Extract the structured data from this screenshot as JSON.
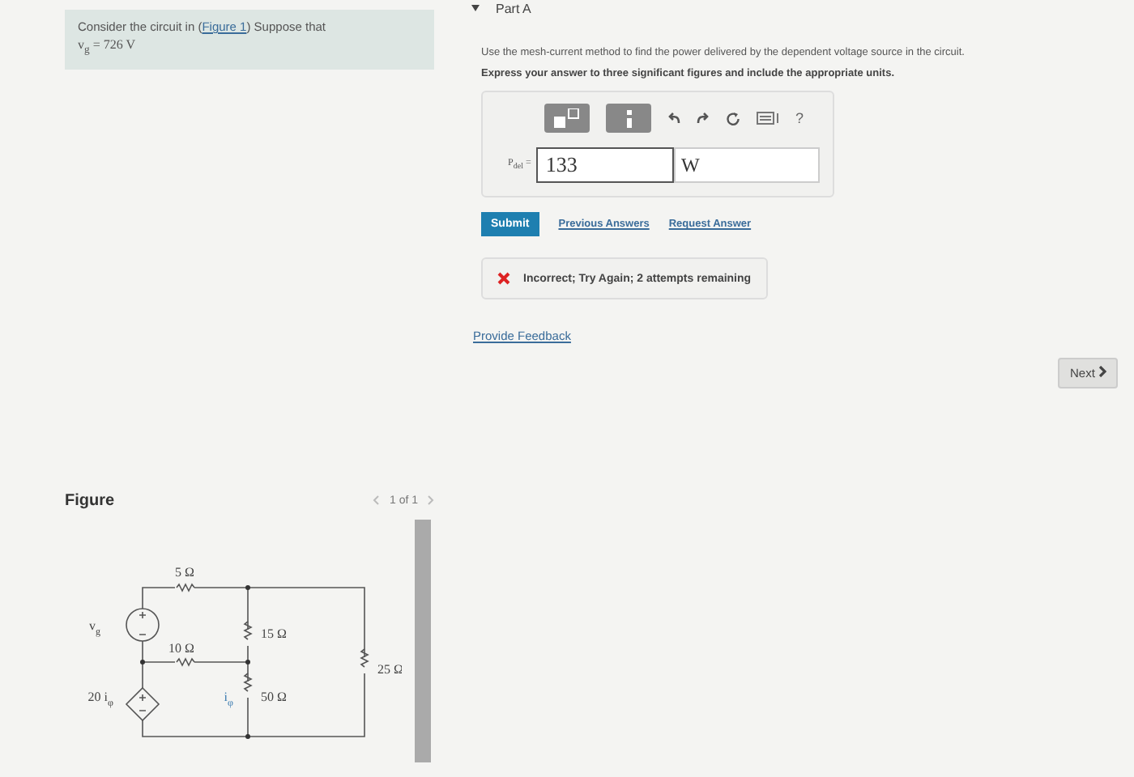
{
  "problem": {
    "text_before": "Consider the circuit in (",
    "link": "Figure 1",
    "text_after": ") Suppose that",
    "given": "v$_{g}$ = 726 V"
  },
  "part": {
    "title": "Part A",
    "expanded": true,
    "instruction": "Use the mesh-current method to find the power delivered by the dependent voltage source in the circuit.",
    "emphasis": "Express your answer to three significant figures and include the appropriate units.",
    "toolbar": {
      "help": "?"
    },
    "answer": {
      "label": "P$_{del}$ =",
      "value": "133",
      "units": "W"
    },
    "buttons": {
      "submit": "Submit",
      "links": [
        "Previous Answers",
        "Request Answer"
      ]
    },
    "feedback": {
      "kind": "incorrect",
      "text": "Incorrect; Try Again; 2 attempts remaining"
    },
    "provide_feedback": "Provide Feedback"
  },
  "next": "Next",
  "figure": {
    "title": "Figure",
    "pager": "1 of 1",
    "labels": [
      {
        "kind": "r5",
        "text": "5 Ω"
      },
      {
        "kind": "r15",
        "text": "15 Ω"
      },
      {
        "kind": "r10",
        "text": "10 Ω"
      },
      {
        "kind": "r25",
        "text": "25 Ω"
      },
      {
        "kind": "r50",
        "text": "50 Ω"
      },
      {
        "kind": "vg",
        "text": "v$_{g}$"
      },
      {
        "kind": "dep",
        "text": "20 i$_{φ}$"
      },
      {
        "kind": "iphi",
        "text": "i$_{φ}$"
      }
    ]
  }
}
